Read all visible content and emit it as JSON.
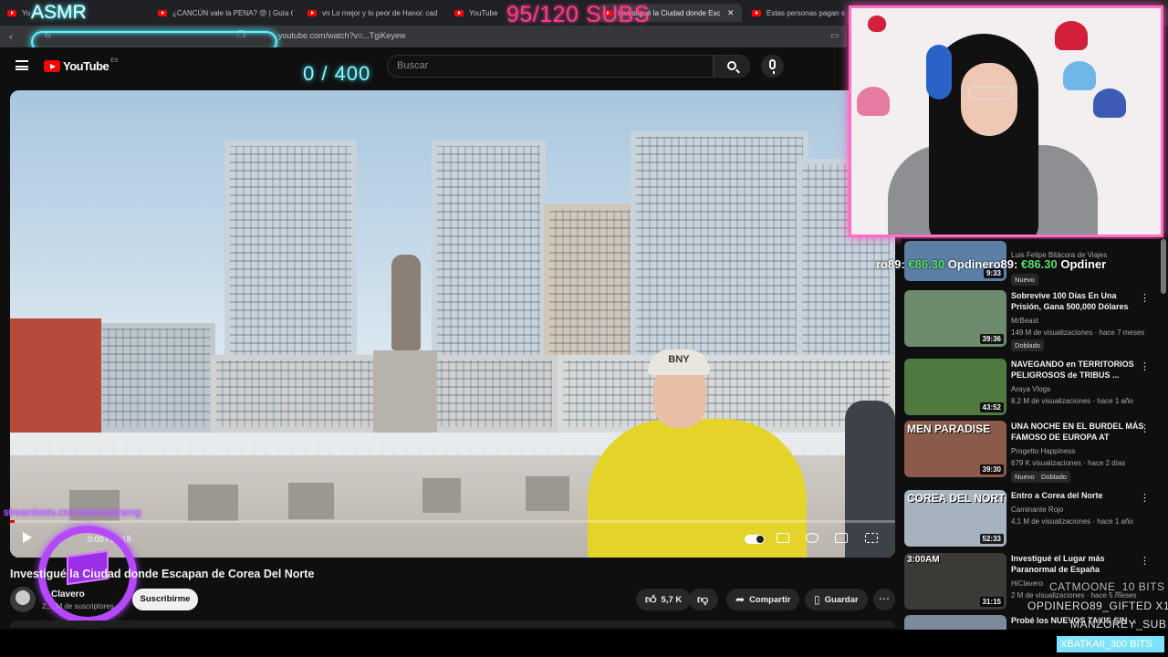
{
  "browser": {
    "tabs": [
      {
        "label": "Yo"
      },
      {
        "label": "¿CANCÚN vale la PENA? 😡 | Guía C"
      },
      {
        "label": "vn Lo mejor y lo peor de Hanoi: cad"
      },
      {
        "label": "YouTube"
      },
      {
        "label": "Investigué la Ciudad donde Esca"
      },
      {
        "label": "Estas personas pagan s"
      }
    ],
    "url": "youtube.com/watch?v=...TgiKeyew",
    "close_glyph": "✕"
  },
  "overlay": {
    "asmr": "ASMR",
    "sub_goal": "95/120 SUBS",
    "counter": "0 / 400",
    "streamloots": "streamloots.com/iamsandramg",
    "cam_name_line": [
      "ro89: ",
      "€86.30",
      " Opdinero89: ",
      "€86.30",
      " Opdiner"
    ],
    "alerts": [
      "CATMOONE_10 BITS",
      "OPDINERO89_GIFTED X1",
      "MANZOREY_SUB",
      "XBATKAII_300 BITS"
    ]
  },
  "youtube": {
    "logo_text": "YouTube",
    "country": "ES",
    "search_placeholder": "Buscar",
    "video": {
      "time": "0:00 / 20:18",
      "progress": 0.005,
      "cap_text": "BNY",
      "title": "Investigué la Ciudad donde Escapan de Corea Del Norte",
      "channel": "Clavero",
      "subscribers": "2,... M de suscriptores",
      "subscribe": "Suscribirme",
      "likes": "5,7 K",
      "share": "Compartir",
      "save": "Guardar",
      "more": "⋯"
    }
  },
  "recommendations": [
    {
      "title": "...",
      "channel": "Luis Felipe Bitácora de Viajes",
      "meta": "...",
      "duration": "9:33",
      "badges": [
        "Nuevo"
      ],
      "thumb_text": ""
    },
    {
      "title": "Sobrevive 100 Días En Una Prisión, Gana 500,000 Dólares",
      "channel": "MrBeast",
      "meta": "149 M de visualizaciones · hace 7 meses",
      "duration": "39:36",
      "badges": [
        "Doblado"
      ],
      "thumb_text": ""
    },
    {
      "title": "NAVEGANDO en TERRITORIOS PELIGROSOS de TRIBUS ...",
      "channel": "Araya Vlogs",
      "meta": "8,2 M de visualizaciones · hace 1 año",
      "duration": "43:52",
      "badges": [],
      "thumb_text": ""
    },
    {
      "title": "UNA NOCHE EN EL BURDEL MÁS FAMOSO DE EUROPA AT",
      "channel": "Progetto Happiness",
      "meta": "679 K visualizaciones · hace 2 días",
      "duration": "39:30",
      "badges": [
        "Nuevo",
        "Doblado"
      ],
      "thumb_text": "MEN PARADISE"
    },
    {
      "title": "Entro a Corea del Norte",
      "channel": "Caminante Rojo",
      "meta": "4,1 M de visualizaciones · hace 1 año",
      "duration": "52:33",
      "badges": [],
      "thumb_text": "COREA DEL NORTE"
    },
    {
      "title": "Investigué el Lugar más Paranormal de España",
      "channel": "HiClavero",
      "meta": "2 M de visualizaciones · hace 5 meses",
      "duration": "31:15",
      "badges": [],
      "thumb_text": "3:00AM"
    },
    {
      "title": "Probé los NUEVOS TAXIS SIN ...",
      "channel": "",
      "meta": "",
      "duration": "",
      "badges": [],
      "thumb_text": ""
    }
  ],
  "colors": {
    "accent_cyan": "#5ff5ff",
    "accent_pink": "#ff3a8d",
    "yt_red": "#ff0000",
    "purple": "#b448ff"
  }
}
